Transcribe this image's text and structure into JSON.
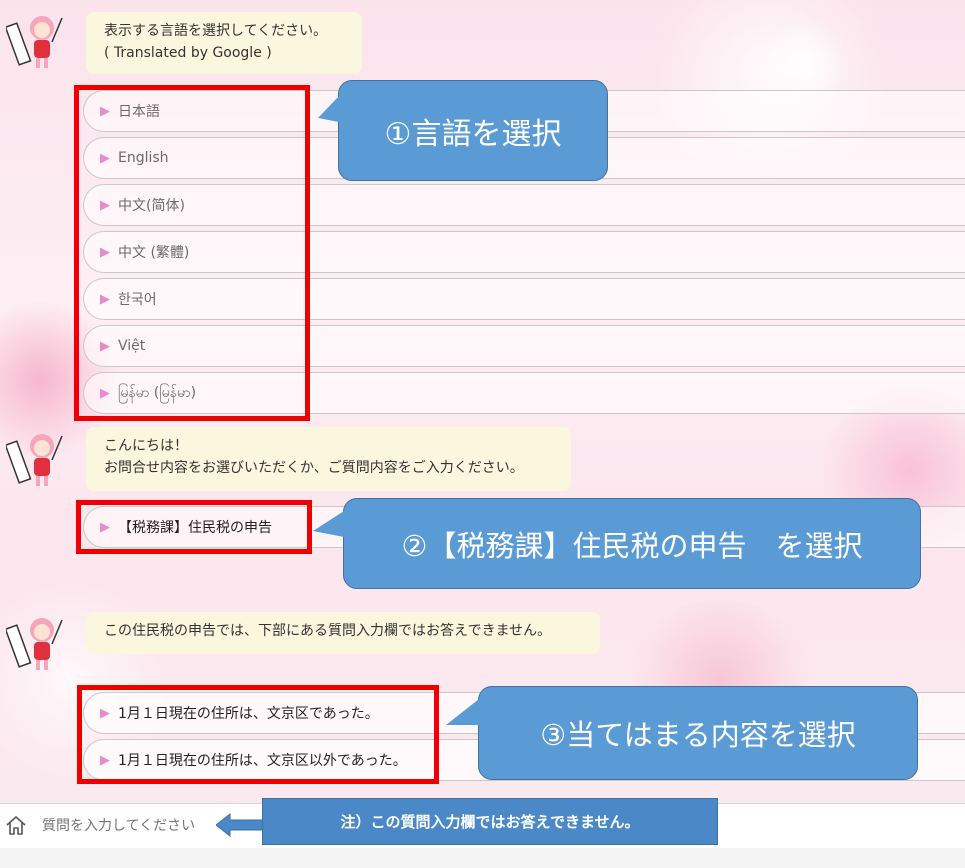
{
  "messages": {
    "first": {
      "line1": "表示する言語を選択してください。",
      "line2": "( Translated by Google )"
    },
    "second": {
      "line1": "こんにちは！",
      "line2": "お問合せ内容をお選びいただくか、ご質問内容をご入力ください。"
    },
    "third": {
      "line1": "この住民税の申告では、下部にある質問入力欄ではお答えできません。"
    }
  },
  "languages": [
    "日本語",
    "English",
    "中文(简体)",
    "中文 (繁體)",
    "한국어",
    "Việt",
    "မြန်မာ (မြန်မာ)"
  ],
  "topic_option": "【税務課】住民税の申告",
  "answer_options": [
    "1月１日現在の住所は、文京区であった。",
    "1月１日現在の住所は、文京区以外であった。"
  ],
  "callouts": {
    "step1": "①言語を選択",
    "step2": "②【税務課】住民税の申告　を選択",
    "step3": "③当てはまる内容を選択",
    "note": "注）この質問入力欄ではお答えできません。"
  },
  "input": {
    "placeholder": "質問を入力してください"
  },
  "icons": {
    "option_marker": "triangle-right-icon",
    "home": "home-icon"
  },
  "colors": {
    "highlight": "#ee0000",
    "callout": "#5b9bd5",
    "bubble": "#fbf7df",
    "marker": "#e88ad0"
  }
}
